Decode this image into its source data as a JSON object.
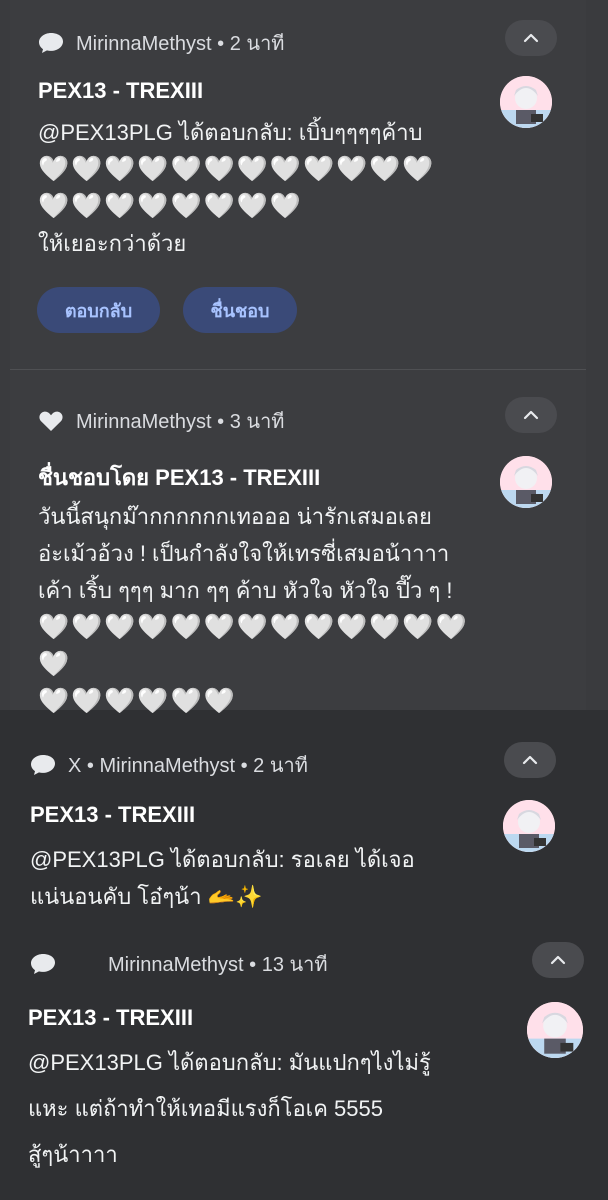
{
  "cards": [
    {
      "meta_text": "MirinnaMethyst • 2 นาที",
      "name": "PEX13 - TREXIII",
      "line1": "@PEX13PLG ได้ตอบกลับ: เบิ้บๆๆๆๆค้าบ",
      "hearts1": "🤍🤍🤍🤍🤍🤍🤍🤍🤍🤍🤍🤍",
      "hearts2": "🤍🤍🤍🤍🤍🤍🤍🤍",
      "line2": "ให้เยอะกว่าด้วย",
      "reply_label": "ตอบกลับ",
      "like_label": "ชื่นชอบ",
      "icon": "chat-bubble-icon"
    },
    {
      "meta_text": "MirinnaMethyst • 3 นาที",
      "name": "ชื่นชอบโดย PEX13 - TREXIII",
      "line1": "วันนี้สนุกม๊ากกกกกกเทอออ น่ารักเสมอเลย",
      "line2": "อ่ะเม้วอ้วง ! เป็นกำลังใจให้เทรซี่เสมอน้าาาา",
      "line3": "เค้า เริ้บ ๆๆๆ มาก ๆๆ ค้าบ หัวใจ หัวใจ ปี๊ว ๆ !",
      "hearts1": "🤍🤍🤍🤍🤍🤍🤍🤍🤍🤍🤍🤍🤍🤍",
      "hearts2": "🤍🤍🤍🤍🤍🤍",
      "icon": "heart-icon"
    },
    {
      "meta_text": "X • MirinnaMethyst • 2 นาที",
      "name": "PEX13 - TREXIII",
      "line1": "@PEX13PLG ได้ตอบกลับ: รอเลย ได้เจอ",
      "line2": "แน่นอนคับ โอ๋ๆน้า 🫴✨",
      "icon": "chat-bubble-icon"
    },
    {
      "meta_text": "MirinnaMethyst • 13 นาที",
      "name": "PEX13 - TREXIII",
      "line1": "@PEX13PLG ได้ตอบกลับ: มันแปกๆไงไม่รู้",
      "line2": "แหะ แต่ถ้าทำให้เทอมีแรงก็โอเค 5555",
      "line3": "สู้ๆน้าาาา",
      "icon": "chat-bubble-icon"
    }
  ],
  "colors": {
    "background": "#303134",
    "chip_bg": "#3a4a78",
    "chip_text": "#a8c3ff"
  }
}
